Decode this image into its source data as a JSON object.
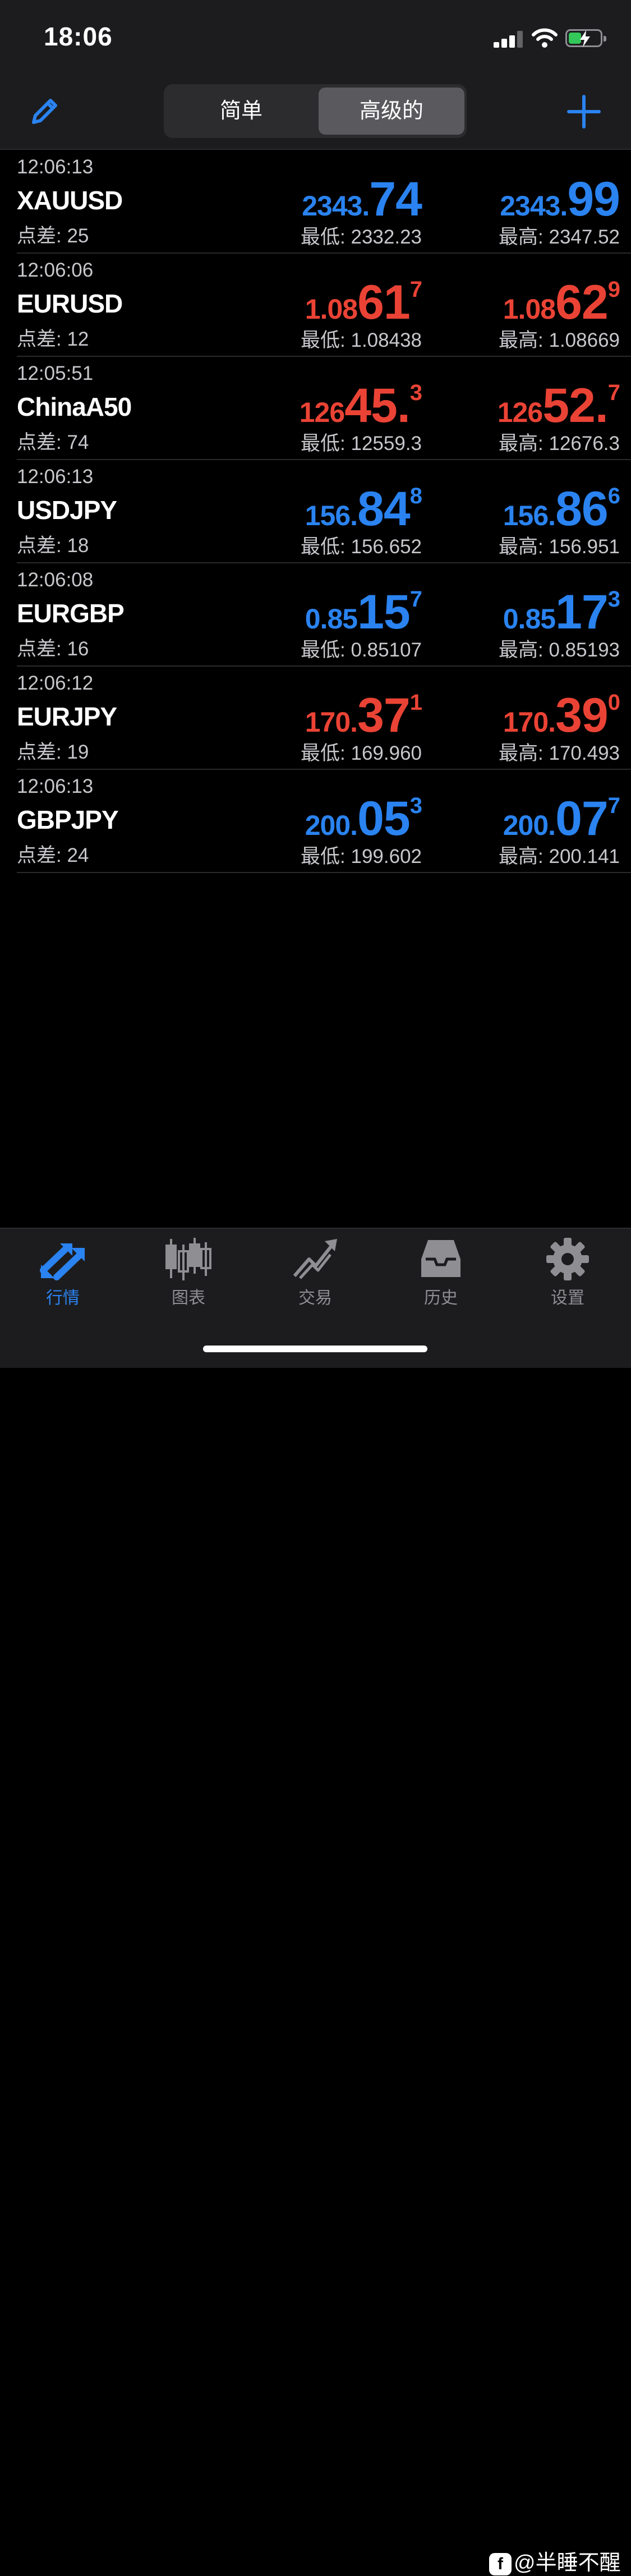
{
  "status_bar": {
    "time": "18:06"
  },
  "nav": {
    "segments": [
      "简单",
      "高级的"
    ],
    "selected": "高级的"
  },
  "quotes": [
    {
      "time": "12:06:13",
      "symbol": "XAUUSD",
      "spread": "点差: 25",
      "bid": {
        "sm": "2343.",
        "big": "74",
        "sup": "",
        "color": "blue"
      },
      "ask": {
        "sm": "2343.",
        "big": "99",
        "sup": "",
        "color": "blue"
      },
      "low": "最低: 2332.23",
      "high": "最高: 2347.52"
    },
    {
      "time": "12:06:06",
      "symbol": "EURUSD",
      "spread": "点差: 12",
      "bid": {
        "sm": "1.08",
        "big": "61",
        "sup": "7",
        "color": "red"
      },
      "ask": {
        "sm": "1.08",
        "big": "62",
        "sup": "9",
        "color": "red"
      },
      "low": "最低: 1.08438",
      "high": "最高: 1.08669"
    },
    {
      "time": "12:05:51",
      "symbol": "ChinaA50",
      "spread": "点差: 74",
      "bid": {
        "sm": "126",
        "big": "45.",
        "sup": "3",
        "color": "red"
      },
      "ask": {
        "sm": "126",
        "big": "52.",
        "sup": "7",
        "color": "red"
      },
      "low": "最低: 12559.3",
      "high": "最高: 12676.3"
    },
    {
      "time": "12:06:13",
      "symbol": "USDJPY",
      "spread": "点差: 18",
      "bid": {
        "sm": "156.",
        "big": "84",
        "sup": "8",
        "color": "blue"
      },
      "ask": {
        "sm": "156.",
        "big": "86",
        "sup": "6",
        "color": "blue"
      },
      "low": "最低: 156.652",
      "high": "最高: 156.951"
    },
    {
      "time": "12:06:08",
      "symbol": "EURGBP",
      "spread": "点差: 16",
      "bid": {
        "sm": "0.85",
        "big": "15",
        "sup": "7",
        "color": "blue"
      },
      "ask": {
        "sm": "0.85",
        "big": "17",
        "sup": "3",
        "color": "blue"
      },
      "low": "最低: 0.85107",
      "high": "最高: 0.85193"
    },
    {
      "time": "12:06:12",
      "symbol": "EURJPY",
      "spread": "点差: 19",
      "bid": {
        "sm": "170.",
        "big": "37",
        "sup": "1",
        "color": "red"
      },
      "ask": {
        "sm": "170.",
        "big": "39",
        "sup": "0",
        "color": "red"
      },
      "low": "最低: 169.960",
      "high": "最高: 170.493"
    },
    {
      "time": "12:06:13",
      "symbol": "GBPJPY",
      "spread": "点差: 24",
      "bid": {
        "sm": "200.",
        "big": "05",
        "sup": "3",
        "color": "blue"
      },
      "ask": {
        "sm": "200.",
        "big": "07",
        "sup": "7",
        "color": "blue"
      },
      "low": "最低: 199.602",
      "high": "最高: 200.141"
    }
  ],
  "tabs": [
    {
      "label": "行情",
      "icon": "quotes-arrows-icon",
      "active": true
    },
    {
      "label": "图表",
      "icon": "candlestick-chart-icon",
      "active": false
    },
    {
      "label": "交易",
      "icon": "trade-trend-icon",
      "active": false
    },
    {
      "label": "历史",
      "icon": "history-inbox-icon",
      "active": false
    },
    {
      "label": "设置",
      "icon": "gear-icon",
      "active": false
    }
  ],
  "watermark": "@半睡不醒",
  "colors": {
    "blue": "#2a83f0",
    "red": "#ea4335",
    "accent": "#2a83f0"
  }
}
